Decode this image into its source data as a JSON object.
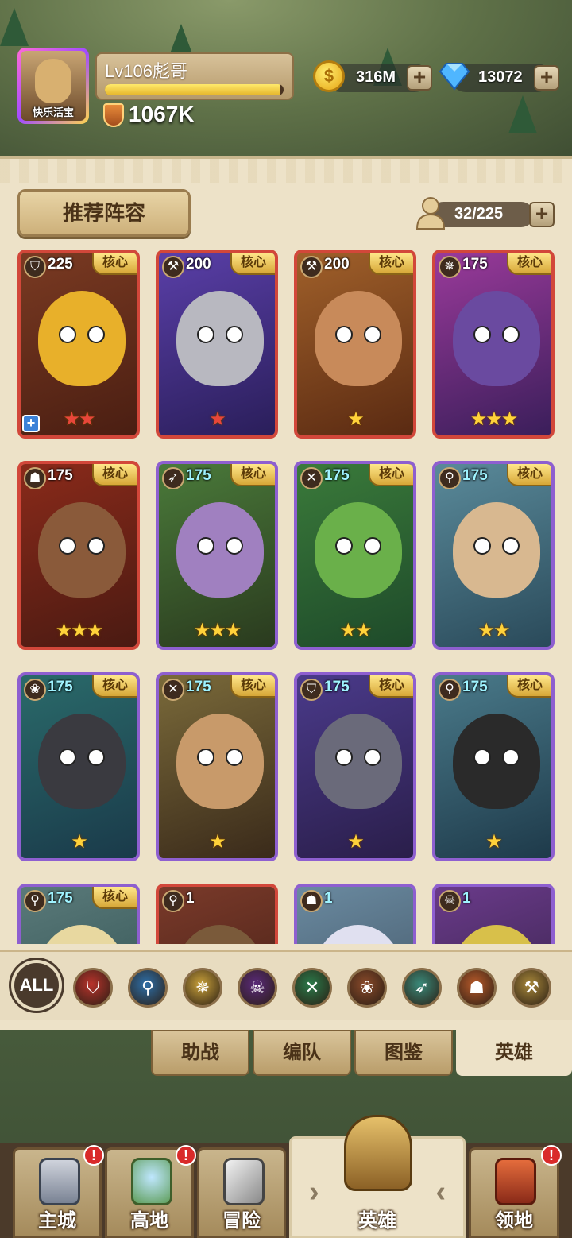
{
  "header": {
    "avatar_name": "快乐活宝",
    "level_label": "Lv106彪哥",
    "xp_fraction": 0.98,
    "power": "1067K",
    "coins": "316M",
    "gems": "13072",
    "coin_symbol": "$",
    "plus": "+"
  },
  "panel": {
    "recommend_label": "推荐阵容",
    "capacity": "32/225",
    "core_label": "核心"
  },
  "heroes": [
    {
      "level": "225",
      "class_icon": "shield-icon",
      "stars": "★★",
      "star_color": "red",
      "frame": "red",
      "core": true
    },
    {
      "level": "200",
      "class_icon": "axe-icon",
      "stars": "★",
      "star_color": "red",
      "frame": "red",
      "core": true
    },
    {
      "level": "200",
      "class_icon": "axe-icon",
      "stars": "★",
      "star_color": "gold",
      "frame": "red",
      "core": true
    },
    {
      "level": "175",
      "class_icon": "emblem-icon",
      "stars": "★★★",
      "star_color": "gold",
      "frame": "red",
      "core": true
    },
    {
      "level": "175",
      "class_icon": "beast-skull-icon",
      "stars": "★★★",
      "star_color": "gold",
      "frame": "red",
      "core": true
    },
    {
      "level": "175",
      "class_icon": "bow-icon",
      "stars": "★★★",
      "star_color": "gold",
      "frame": "purple",
      "core": true
    },
    {
      "level": "175",
      "class_icon": "crossed-blades-icon",
      "stars": "★★",
      "star_color": "gold",
      "frame": "purple",
      "core": true
    },
    {
      "level": "175",
      "class_icon": "staff-icon",
      "stars": "★★",
      "star_color": "gold",
      "frame": "purple",
      "core": true
    },
    {
      "level": "175",
      "class_icon": "paw-icon",
      "stars": "★",
      "star_color": "gold",
      "frame": "purple",
      "core": true
    },
    {
      "level": "175",
      "class_icon": "crossed-blades-icon",
      "stars": "★",
      "star_color": "gold",
      "frame": "purple",
      "core": true
    },
    {
      "level": "175",
      "class_icon": "shield-icon",
      "stars": "★",
      "star_color": "gold",
      "frame": "purple",
      "core": true
    },
    {
      "level": "175",
      "class_icon": "staff-icon",
      "stars": "★",
      "star_color": "gold",
      "frame": "purple",
      "core": true
    },
    {
      "level": "175",
      "class_icon": "staff-icon",
      "stars": "",
      "star_color": "gold",
      "frame": "purple",
      "core": true
    },
    {
      "level": "1",
      "class_icon": "staff-icon",
      "stars": "",
      "star_color": "gold",
      "frame": "red",
      "core": false
    },
    {
      "level": "1",
      "class_icon": "beast-skull-icon",
      "stars": "",
      "star_color": "gold",
      "frame": "purple",
      "core": false
    },
    {
      "level": "1",
      "class_icon": "skull-icon",
      "stars": "",
      "star_color": "gold",
      "frame": "purple",
      "core": false
    }
  ],
  "filters": {
    "all_label": "ALL",
    "items": [
      "shield-icon",
      "staff-icon",
      "emblem-icon",
      "skull-icon",
      "crossed-blades-icon",
      "paw-icon",
      "bow-icon",
      "beast-skull-icon",
      "axe-icon"
    ]
  },
  "tabs": [
    "助战",
    "编队",
    "图鉴",
    "英雄"
  ],
  "bottom_nav": [
    {
      "label": "主城",
      "alert": "!"
    },
    {
      "label": "高地",
      "alert": "!"
    },
    {
      "label": "冒险",
      "alert": ""
    },
    {
      "label": "英雄",
      "alert": ""
    },
    {
      "label": "领地",
      "alert": "!"
    }
  ],
  "colors": {
    "panel_bg": "#ede2c8",
    "red_frame": "#d2473a",
    "purple_frame": "#8e5fd0",
    "gold": "#ffd23a",
    "alert": "#d92a2a"
  }
}
